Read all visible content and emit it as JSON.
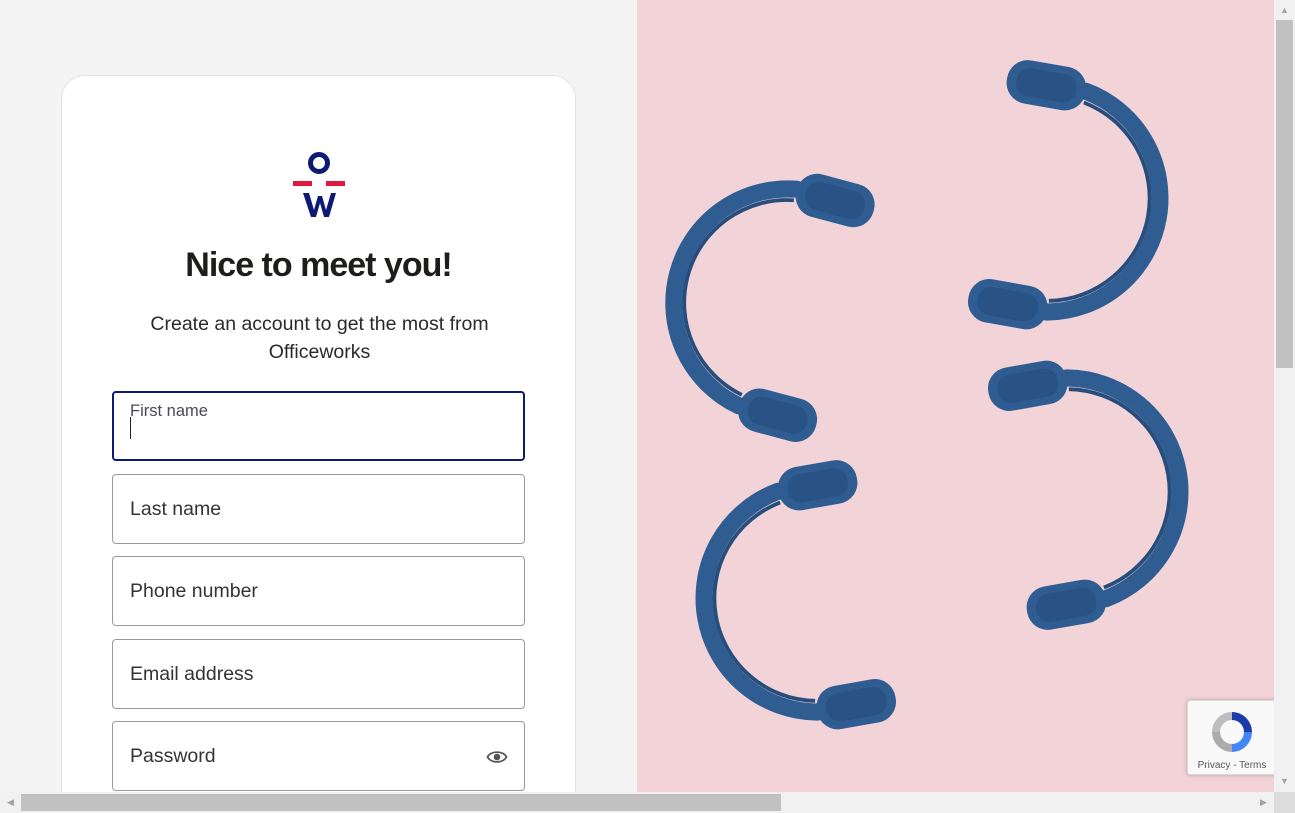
{
  "signup": {
    "title": "Nice to meet you!",
    "subtitle": "Create an account to get the most from Officeworks",
    "fields": {
      "first_name": {
        "label": "First name",
        "value": ""
      },
      "last_name": {
        "placeholder": "Last name"
      },
      "phone": {
        "placeholder": "Phone number"
      },
      "email": {
        "placeholder": "Email address"
      },
      "password": {
        "placeholder": "Password"
      }
    }
  },
  "recaptcha": {
    "privacy": "Privacy",
    "separator": "-",
    "terms": "Terms"
  },
  "colors": {
    "brand_navy": "#0d1a73",
    "brand_red": "#e01a3f",
    "photo_background": "#f2d3d8",
    "headphone_blue": "#25578f"
  }
}
